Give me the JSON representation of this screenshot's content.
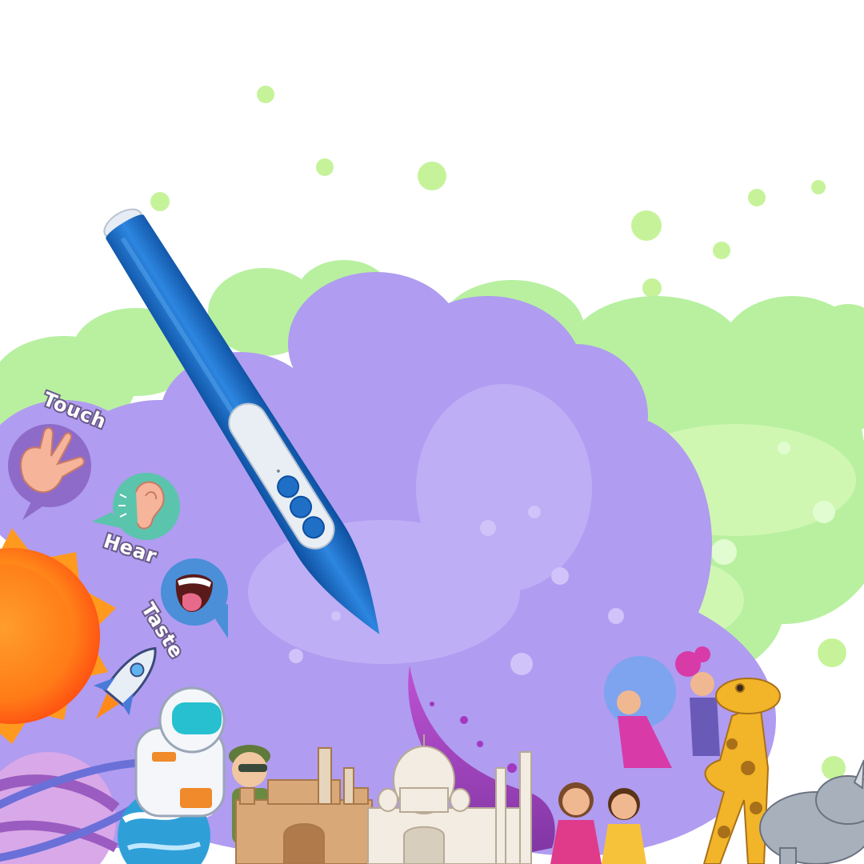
{
  "senses": [
    {
      "label": "Touch",
      "icon": "hand-icon"
    },
    {
      "label": "Hear",
      "icon": "ear-icon"
    },
    {
      "label": "Taste",
      "icon": "mouth-icon"
    }
  ],
  "colors": {
    "background": "#ffffff",
    "green_cloud": "#b8f0a0",
    "purple_cloud": "#b09cf0",
    "pen_blue": "#1f6fc6",
    "pen_tip": "#e8eef6",
    "bubble_purple": "#8e6bc8",
    "bubble_teal": "#5bc4ac",
    "bubble_blue": "#4a8fd8"
  }
}
